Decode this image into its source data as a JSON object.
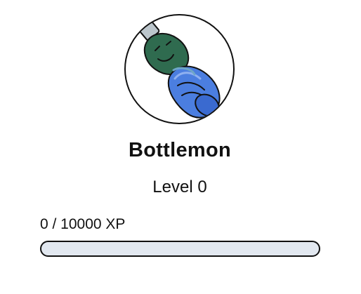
{
  "pet": {
    "name": "Bottlemon",
    "level_text": "Level 0",
    "avatar_icon": "water-bottle-icon"
  },
  "xp": {
    "text": "0 / 10000 XP",
    "current": 0,
    "max": 10000
  },
  "colors": {
    "bottle_cap": "#2f6b4f",
    "bottle_body": "#4b7ee0",
    "bar_track": "#e2e8f0",
    "outline": "#111111"
  }
}
